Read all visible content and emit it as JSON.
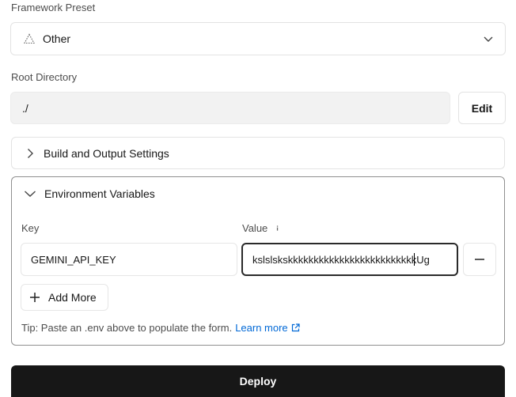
{
  "framework": {
    "label": "Framework Preset",
    "selected": "Other",
    "icon": "triangle-icon"
  },
  "root": {
    "label": "Root Directory",
    "value": "./",
    "edit_label": "Edit"
  },
  "build": {
    "title": "Build and Output Settings"
  },
  "env": {
    "title": "Environment Variables",
    "key_label": "Key",
    "value_label": "Value",
    "rows": [
      {
        "key": "GEMINI_API_KEY",
        "value_before_cursor": "kslslskskkkkkkkkkkkkkkkkkkkkkkkkk",
        "value_after_cursor": "Ug"
      }
    ],
    "add_more_label": "Add More",
    "tip_text": "Tip: Paste an .env above to populate the form.",
    "learn_more": "Learn more"
  },
  "deploy": {
    "label": "Deploy"
  },
  "colors": {
    "link": "#0068d6",
    "deploy_bg": "#171717",
    "focused_border": "#2a2a2a"
  }
}
